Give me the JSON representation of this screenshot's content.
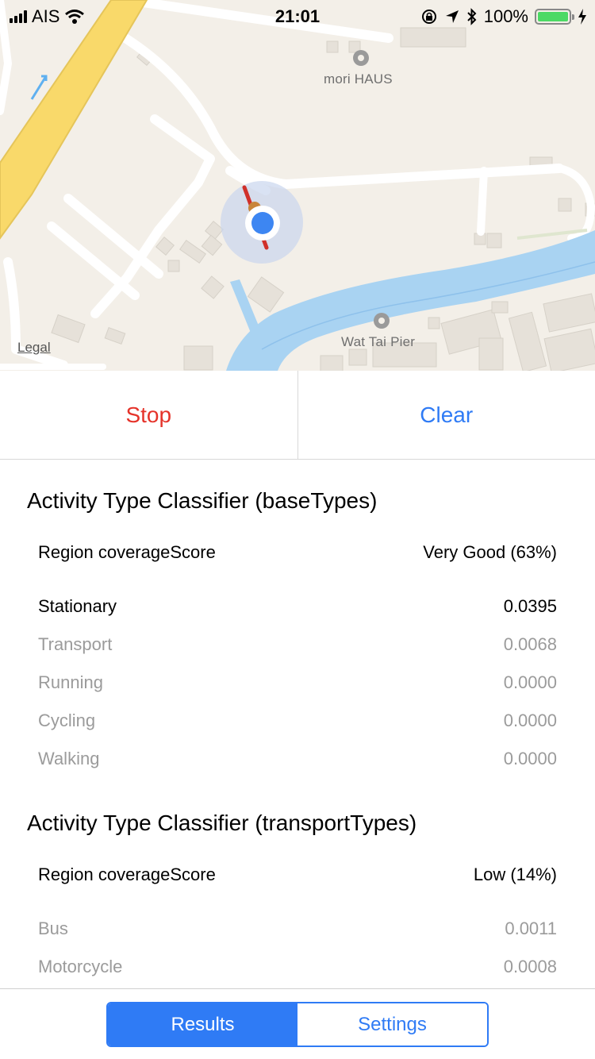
{
  "status_bar": {
    "carrier": "AIS",
    "time": "21:01",
    "battery": "100%"
  },
  "map": {
    "labels": {
      "poi1": "mori HAUS",
      "poi2": "Wat Tai Pier",
      "legal": "Legal"
    }
  },
  "actions": {
    "stop": "Stop",
    "clear": "Clear"
  },
  "base_types": {
    "title": "Activity Type Classifier (baseTypes)",
    "coverage_label": "Region coverageScore",
    "coverage_value": "Very Good (63%)",
    "items": [
      {
        "label": "Stationary",
        "value": "0.0395"
      },
      {
        "label": "Transport",
        "value": "0.0068"
      },
      {
        "label": "Running",
        "value": "0.0000"
      },
      {
        "label": "Cycling",
        "value": "0.0000"
      },
      {
        "label": "Walking",
        "value": "0.0000"
      }
    ]
  },
  "transport_types": {
    "title": "Activity Type Classifier (transportTypes)",
    "coverage_label": "Region coverageScore",
    "coverage_value": "Low (14%)",
    "items": [
      {
        "label": "Bus",
        "value": "0.0011"
      },
      {
        "label": "Motorcycle",
        "value": "0.0008"
      }
    ]
  },
  "tabs": {
    "results": "Results",
    "settings": "Settings"
  },
  "colors": {
    "accent": "#2f7bf5",
    "destructive": "#e5332a",
    "battery": "#4cd964"
  }
}
